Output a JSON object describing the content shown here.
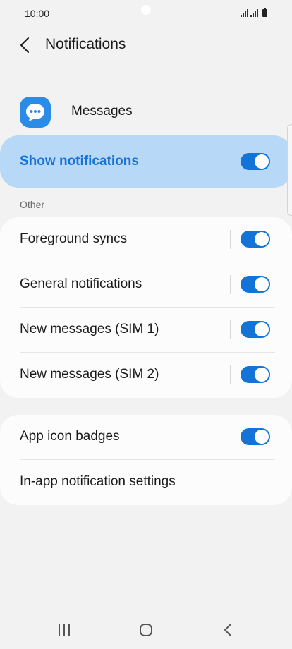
{
  "status_bar": {
    "time": "10:00",
    "icons": [
      "signal-icon",
      "signal-icon",
      "battery-icon"
    ]
  },
  "header": {
    "title": "Notifications",
    "back_icon": "chevron-left-icon"
  },
  "app": {
    "name": "Messages",
    "icon": "chat-bubble-icon",
    "icon_color": "#2a8ce6"
  },
  "show_notifications": {
    "label": "Show notifications",
    "enabled": true,
    "accent": "#1473d6",
    "highlight": "#b8d8f7"
  },
  "other_section": {
    "label": "Other",
    "items": [
      {
        "label": "Foreground syncs",
        "enabled": true
      },
      {
        "label": "General notifications",
        "enabled": true
      },
      {
        "label": "New messages (SIM 1)",
        "enabled": true
      },
      {
        "label": "New messages (SIM 2)",
        "enabled": true
      }
    ]
  },
  "extra_section": {
    "items": [
      {
        "label": "App icon badges",
        "enabled": true
      },
      {
        "label": "In-app notification settings"
      }
    ]
  },
  "nav_bar": {
    "buttons": [
      "recent-apps-icon",
      "home-icon",
      "back-icon"
    ]
  }
}
